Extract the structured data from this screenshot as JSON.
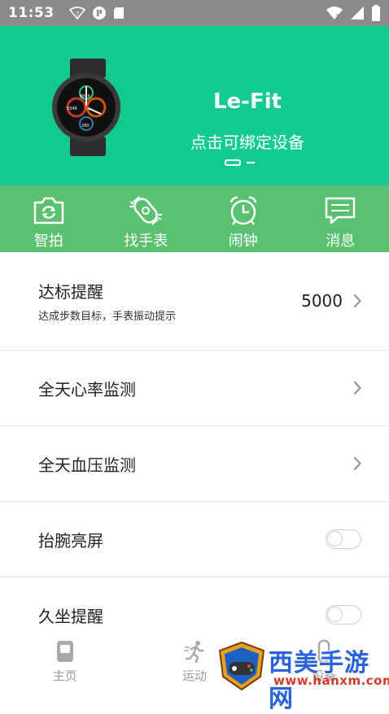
{
  "status_bar": {
    "time": "11:53"
  },
  "header": {
    "app_name": "Le-Fit",
    "bind_prompt": "点击可绑定设备",
    "watch_face": {
      "top": "8815",
      "mid": "5349",
      "bottom": "280"
    }
  },
  "quick_actions": [
    {
      "label": "智拍",
      "icon": "camera-icon"
    },
    {
      "label": "找手表",
      "icon": "find-watch-icon"
    },
    {
      "label": "闹钟",
      "icon": "alarm-clock-icon"
    },
    {
      "label": "消息",
      "icon": "message-icon"
    }
  ],
  "settings": {
    "goal_reminder": {
      "title": "达标提醒",
      "subtitle": "达成步数目标，手表振动提示",
      "value": "5000"
    },
    "heart_rate": {
      "title": "全天心率监测"
    },
    "blood_pressure": {
      "title": "全天血压监测"
    },
    "raise_wrist": {
      "title": "抬腕亮屏",
      "enabled": false
    },
    "sedentary": {
      "title": "久坐提醒",
      "enabled": false
    }
  },
  "bottom_nav": [
    {
      "label": "主页",
      "icon": "home-icon"
    },
    {
      "label": "运动",
      "icon": "running-icon"
    },
    {
      "label": "设备",
      "icon": "device-icon"
    }
  ],
  "watermark": {
    "text": "西美手游网",
    "url": "www.hanxm.com"
  },
  "colors": {
    "header_bg": "#12c98f",
    "quickbar_bg": "#5bc172",
    "status_bg": "#8a8a8a",
    "watermark_blue": "#2b62d9",
    "watermark_red": "#d23b2a"
  }
}
